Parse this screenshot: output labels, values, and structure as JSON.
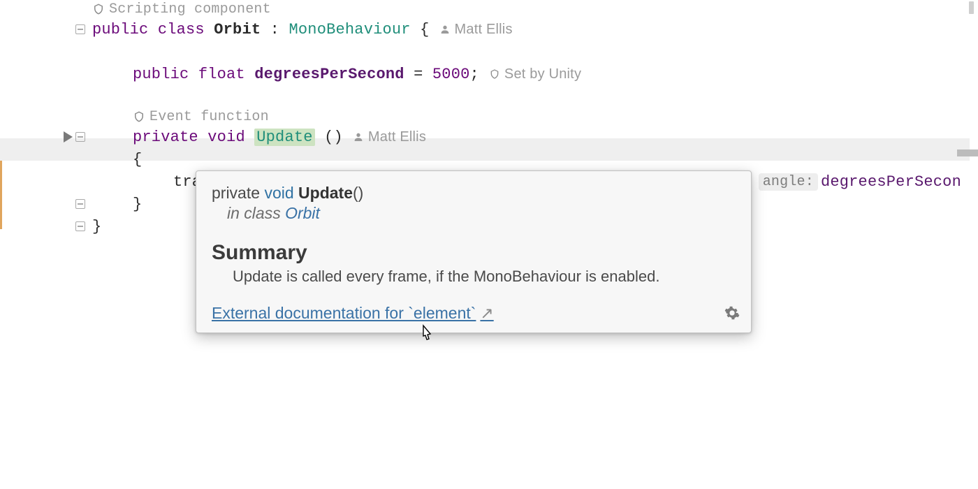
{
  "code": {
    "hint_scripting": "Scripting component",
    "hint_event": "Event function",
    "hint_setby": "Set by Unity",
    "author": "Matt Ellis",
    "kw_public": "public",
    "kw_class": "class",
    "kw_private": "private",
    "kw_void": "void",
    "kw_float": "float",
    "classname": "Orbit",
    "basename": "MonoBehaviour",
    "field_name": "degreesPerSecond",
    "field_val": "5000",
    "method_name": "Update",
    "call_tr": "tra",
    "param_angle_label": "angle:",
    "param_angle_val": "degreesPerSecon",
    "brace_open": "{",
    "brace_close": "}",
    "parens": "()",
    "eq": " = ",
    "colon_space": " : ",
    "semicolon": ";",
    "comma": ","
  },
  "popup": {
    "sig_private": "private",
    "sig_void": "void",
    "sig_name": "Update",
    "sig_parens": "()",
    "inclass_prefix": "in class ",
    "inclass_link": "Orbit",
    "summary_heading": "Summary",
    "summary_text": "Update is called every frame, if the MonoBehaviour is enabled.",
    "ext_link_text": "External documentation for `element`"
  }
}
